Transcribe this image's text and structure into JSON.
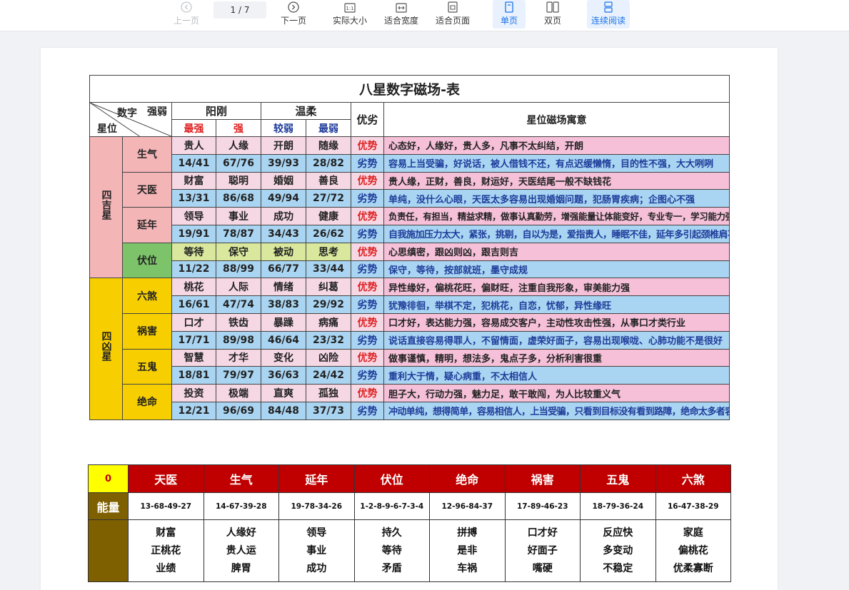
{
  "toolbar": {
    "prev": "上一页",
    "page_current": "1",
    "page_total": "/ 7",
    "next": "下一页",
    "actual_size": "实际大小",
    "fit_width": "适合宽度",
    "fit_page": "适合页面",
    "single": "单页",
    "double": "双页",
    "continuous": "连续阅读"
  },
  "table": {
    "title": "八星数字磁场-表",
    "corner": {
      "number": "数字",
      "strength": "强弱",
      "star": "星位"
    },
    "yang": "阳刚",
    "wen": "温柔",
    "advdis": "优劣",
    "meaning_header": "星位磁场寓意",
    "levels": [
      "最强",
      "强",
      "较弱",
      "最弱"
    ],
    "groups": [
      {
        "name": "四吉星"
      },
      {
        "name": "四凶星"
      }
    ],
    "stars": [
      {
        "name": "生气",
        "words": [
          "贵人",
          "人缘",
          "开朗",
          "随缘"
        ],
        "nums": [
          "14/41",
          "67/76",
          "39/93",
          "28/82"
        ],
        "adv": "优势",
        "dis": "劣势",
        "adv_text": "心态好，人缘好，贵人多，凡事不太纠结，开朗",
        "dis_text": "容易上当受骗，好说话，被人借钱不还，有点迟缓懒惰，目的性不强，大大咧咧"
      },
      {
        "name": "天医",
        "words": [
          "财富",
          "聪明",
          "婚姻",
          "善良"
        ],
        "nums": [
          "13/31",
          "86/68",
          "49/94",
          "27/72"
        ],
        "adv": "优势",
        "dis": "劣势",
        "adv_text": "贵人缘，正财，善良，财运好，天医结尾一般不缺钱花",
        "dis_text": "单纯，没什么心眼，天医太多容易出现婚姻问题，犯肠胃疾病；企图心不强"
      },
      {
        "name": "延年",
        "words": [
          "领导",
          "事业",
          "成功",
          "健康"
        ],
        "nums": [
          "19/91",
          "78/87",
          "34/43",
          "26/62"
        ],
        "adv": "优势",
        "dis": "劣势",
        "adv_text": "负责任，有担当，精益求精，做事认真勤劳，增强能量让体能变好，专业专一，学习能力强",
        "dis_text": "自我施加压力太大，紧张，挑剔，自以为是，爱指责人，睡眠不佳，延年多引起颈椎肩不舒服，严重者容易掉头发"
      },
      {
        "name": "伏位",
        "words": [
          "等待",
          "保守",
          "被动",
          "思考"
        ],
        "nums": [
          "11/22",
          "88/99",
          "66/77",
          "33/44"
        ],
        "adv": "优势",
        "dis": "劣势",
        "adv_text": "心思缜密，跟凶则凶，跟吉则吉",
        "dis_text": "保守，等待，按部就班，墨守成规"
      },
      {
        "name": "六煞",
        "words": [
          "桃花",
          "人际",
          "情绪",
          "纠葛"
        ],
        "nums": [
          "16/61",
          "47/74",
          "38/83",
          "29/92"
        ],
        "adv": "优势",
        "dis": "劣势",
        "adv_text": "异性缘好，偏桃花旺，偏财旺，注重自我形象，审美能力强",
        "dis_text": "犹豫徘徊，举棋不定，犯桃花，自恋，忧郁，异性缘旺"
      },
      {
        "name": "祸害",
        "words": [
          "口才",
          "铁齿",
          "暴躁",
          "病痛"
        ],
        "nums": [
          "17/71",
          "89/98",
          "46/64",
          "23/32"
        ],
        "adv": "优势",
        "dis": "劣势",
        "adv_text": "口才好，表达能力强，容易成交客户，主动性攻击性强，从事口才类行业",
        "dis_text": "说话直接容易得罪人，不留情面，虚荣好面子，容易出现喉咙、心肺功能不是很好"
      },
      {
        "name": "五鬼",
        "words": [
          "智慧",
          "才华",
          "变化",
          "凶险"
        ],
        "nums": [
          "18/81",
          "79/97",
          "36/63",
          "24/42"
        ],
        "adv": "优势",
        "dis": "劣势",
        "adv_text": "做事谨慎，精明，想法多，鬼点子多，分析利害很重",
        "dis_text": "重利大于情，疑心病重，不太相信人"
      },
      {
        "name": "绝命",
        "words": [
          "投资",
          "极端",
          "直爽",
          "孤独"
        ],
        "nums": [
          "12/21",
          "96/69",
          "84/48",
          "37/73"
        ],
        "adv": "优势",
        "dis": "劣势",
        "adv_text": "胆子大，行动力强，魅力足，敢干敢闯，为人比较重义气",
        "dis_text": "冲动单纯，想得简单，容易相信人，上当受骗，只看到目标没有看到路障，绝命太多者容易空有资产缺乏现金流"
      }
    ]
  },
  "table2": {
    "zero": "0",
    "energy_label": "能量",
    "columns": [
      {
        "name": "天医",
        "nums": "13-68-49-27",
        "traits": [
          "财富",
          "正桃花",
          "业绩"
        ]
      },
      {
        "name": "生气",
        "nums": "14-67-39-28",
        "traits": [
          "人缘好",
          "贵人运",
          "脾胃"
        ]
      },
      {
        "name": "延年",
        "nums": "19-78-34-26",
        "traits": [
          "领导",
          "事业",
          "成功"
        ]
      },
      {
        "name": "伏位",
        "nums": "1-2-8-9-6-7-3-4",
        "traits": [
          "持久",
          "等待",
          "矛盾"
        ]
      },
      {
        "name": "绝命",
        "nums": "12-96-84-37",
        "traits": [
          "拼搏",
          "是非",
          "车祸"
        ]
      },
      {
        "name": "祸害",
        "nums": "17-89-46-23",
        "traits": [
          "口才好",
          "好面子",
          "嘴硬"
        ]
      },
      {
        "name": "五鬼",
        "nums": "18-79-36-24",
        "traits": [
          "反应快",
          "多变动",
          "不稳定"
        ]
      },
      {
        "name": "六煞",
        "nums": "16-47-38-29",
        "traits": [
          "家庭",
          "偏桃花",
          "优柔寡断"
        ]
      }
    ]
  },
  "colors": {
    "accent_blue": "#1a73e8",
    "header_red": "#c00000",
    "label_brown": "#7f6000",
    "zero_yellow": "#ffff00"
  }
}
